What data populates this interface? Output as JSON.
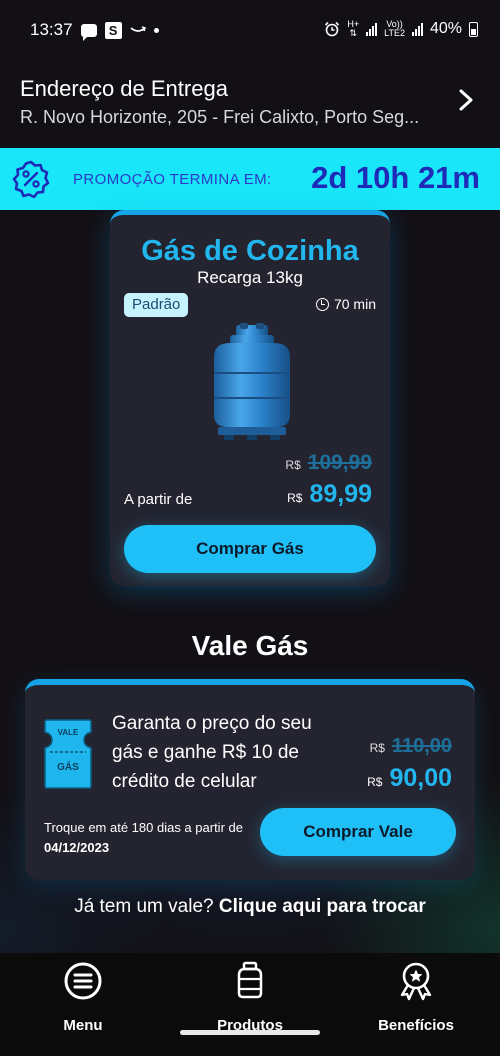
{
  "status_bar": {
    "time": "13:37",
    "network_label_top": "H+",
    "network_label_volte": "Vo))",
    "network_label_lte": "LTE2",
    "battery": "40%"
  },
  "address": {
    "title": "Endereço de Entrega",
    "line": "R. Novo Horizonte, 205 - Frei Calixto, Porto Seg..."
  },
  "promo": {
    "label": "PROMOÇÃO TERMINA EM:",
    "countdown": "2d 10h 21m",
    "colors": {
      "background": "#19e6f8",
      "text": "#1d2bb8"
    }
  },
  "gas_card": {
    "title": "Gás de Cozinha",
    "subtitle": "Recarga 13kg",
    "tag": "Padrão",
    "delivery_time": "70 min",
    "old_currency": "R$",
    "old_price": "109,99",
    "from_label": "A partir de",
    "currency": "R$",
    "price": "89,99",
    "button": "Comprar Gás"
  },
  "vale_gas": {
    "heading": "Vale Gás",
    "ticket_line1": "VALE",
    "ticket_line2": "GÁS",
    "description": "Garanta o preço do seu gás e ganhe R$ 10 de crédito de celular",
    "old_currency": "R$",
    "old_price": "110,00",
    "currency": "R$",
    "price": "90,00",
    "note_prefix": "Troque em até 180 dias a partir de ",
    "note_date": "04/12/2023",
    "button": "Comprar Vale"
  },
  "trade": {
    "prefix": "Já tem um vale? ",
    "link": "Clique aqui para trocar"
  },
  "nav": {
    "items": [
      {
        "label": "Menu",
        "icon": "menu-icon"
      },
      {
        "label": "Produtos",
        "icon": "gas-cylinder-icon"
      },
      {
        "label": "Benefícios",
        "icon": "award-badge-icon"
      }
    ]
  },
  "colors": {
    "accent": "#21b6ee",
    "button": "#1fbff8",
    "card": "#232430",
    "background": "#131015"
  }
}
